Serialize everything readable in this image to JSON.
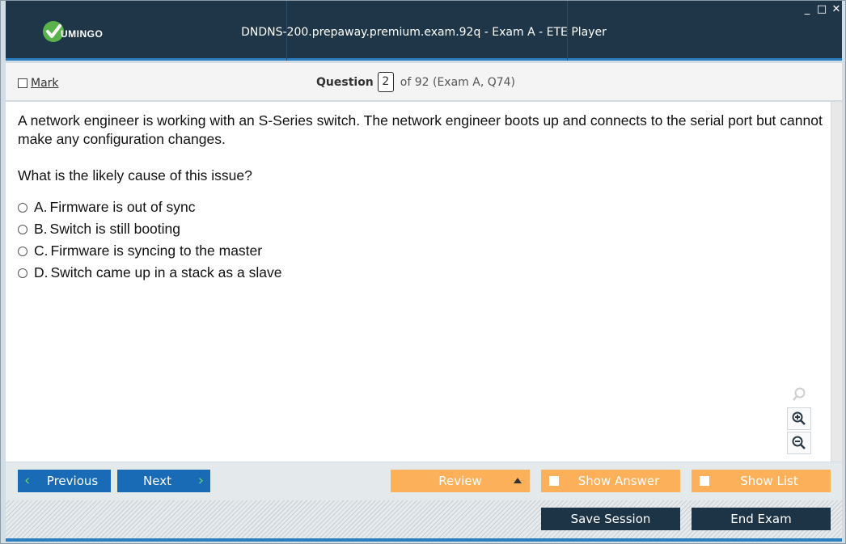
{
  "app": {
    "logo_text": "UMINGO",
    "title": "DNDNS-200.prepaway.premium.exam.92q - Exam A - ETE Player",
    "window_controls": [
      "_",
      "□",
      "✕"
    ]
  },
  "question_bar": {
    "mark_label": "Mark",
    "question_label": "Question",
    "question_number": "2",
    "of_text": "of 92 (Exam A, Q74)"
  },
  "question": {
    "text": "A network engineer is working with an S-Series switch. The network engineer boots up and connects to the serial port but cannot make any configuration changes.",
    "prompt": "What is the likely cause of this issue?",
    "options": [
      {
        "letter": "A.",
        "text": "Firmware is out of sync"
      },
      {
        "letter": "B.",
        "text": "Switch is still booting"
      },
      {
        "letter": "C.",
        "text": "Firmware is syncing to the master"
      },
      {
        "letter": "D.",
        "text": "Switch came up in a stack as a slave"
      }
    ]
  },
  "zoom": {
    "icons": [
      "zoom-reset-icon",
      "zoom-in-icon",
      "zoom-out-icon"
    ]
  },
  "nav": {
    "previous": "Previous",
    "next": "Next",
    "review": "Review",
    "show_answer": "Show Answer",
    "show_list": "Show List"
  },
  "footer": {
    "save_session": "Save Session",
    "end_exam": "End Exam"
  },
  "colors": {
    "titlebar": "#1f3648",
    "accent_blue": "#1a6bb5",
    "orange": "#fdb05a",
    "dark": "#1d3346",
    "logo_green": "#5ab34a"
  }
}
